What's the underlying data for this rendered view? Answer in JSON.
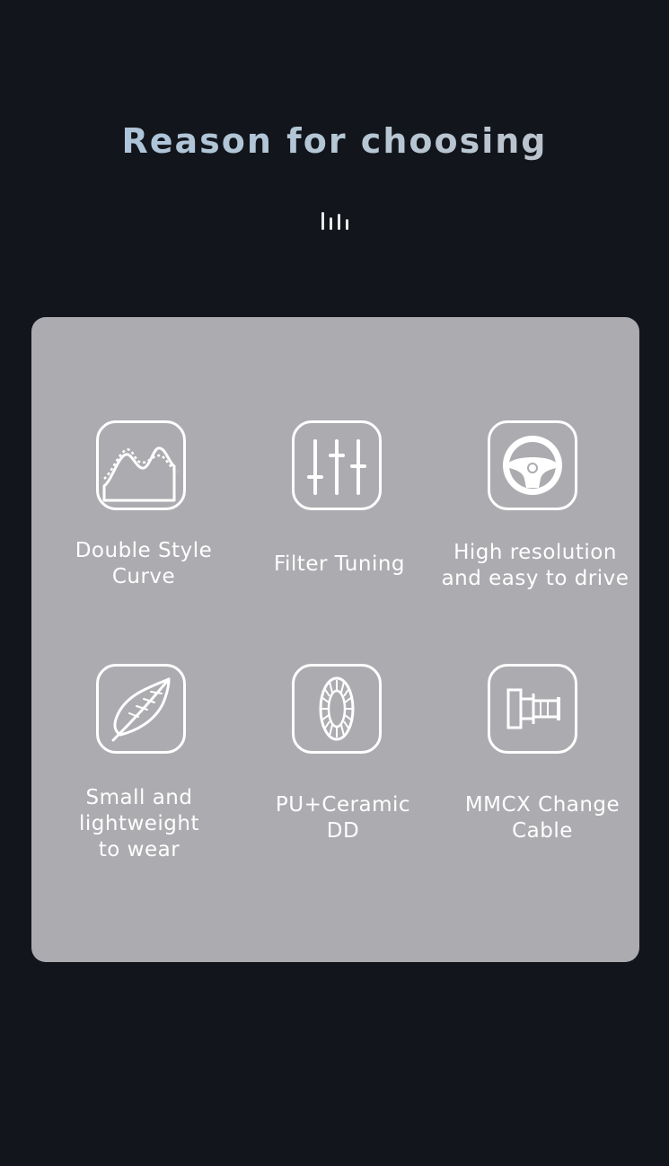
{
  "header": {
    "title": "Reason for choosing"
  },
  "features": [
    {
      "label_line1": "Double Style",
      "label_line2": "Curve",
      "icon": "curve-chart-icon"
    },
    {
      "label_line1": "Filter Tuning",
      "label_line2": "",
      "icon": "equalizer-sliders-icon"
    },
    {
      "label_line1": "High resolution",
      "label_line2": "and easy to drive",
      "icon": "steering-wheel-icon"
    },
    {
      "label_line1": "Small and",
      "label_line2": "lightweight",
      "label_line3": "to wear",
      "icon": "feather-icon"
    },
    {
      "label_line1": "PU+Ceramic",
      "label_line2": "DD",
      "icon": "diaphragm-driver-icon"
    },
    {
      "label_line1": "MMCX Change",
      "label_line2": "Cable",
      "icon": "mmcx-connector-icon"
    }
  ],
  "colors": {
    "background": "#12151c",
    "panel": "#acacb0",
    "icon_stroke": "#ffffff",
    "title_gradient_start": "#a9c3db",
    "title_gradient_end": "#bfc3c9"
  }
}
